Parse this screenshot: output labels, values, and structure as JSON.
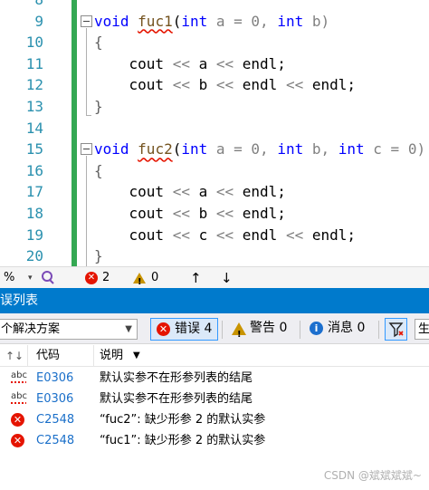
{
  "editor": {
    "lines": [
      {
        "num": "8"
      },
      {
        "num": "9"
      },
      {
        "num": "10"
      },
      {
        "num": "11"
      },
      {
        "num": "12"
      },
      {
        "num": "13"
      },
      {
        "num": "14"
      },
      {
        "num": "15"
      },
      {
        "num": "16"
      },
      {
        "num": "17"
      },
      {
        "num": "18"
      },
      {
        "num": "19"
      },
      {
        "num": "20"
      }
    ],
    "code": {
      "l9_kw": "void",
      "l9_fn": "fuc1",
      "l9_open": "(",
      "l9_int1": "int",
      "l9_a": " a = 0, ",
      "l9_int2": "int",
      "l9_b": " b)",
      "l10": "{",
      "l11": "    cout << a << endl;",
      "l12": "    cout << b << endl << endl;",
      "l13": "}",
      "l15_kw": "void",
      "l15_fn": "fuc2",
      "l15_open": "(",
      "l15_int1": "int",
      "l15_a": " a = 0, ",
      "l15_int2": "int",
      "l15_b": " b, ",
      "l15_int3": "int",
      "l15_c": " c = 0)",
      "l16": "{",
      "l17": "    cout << a << endl;",
      "l18": "    cout << b << endl;",
      "l19": "    cout << c << endl << endl;",
      "l20": "}"
    }
  },
  "status_strip": {
    "zoom": "%",
    "error_count": "2",
    "warning_count": "0",
    "up_arrow": "↑",
    "down_arrow": "↓"
  },
  "panel": {
    "title": "误列表",
    "scope": "个解决方案",
    "errors_label": "错误 4",
    "warnings_label": "警告 0",
    "messages_label": "消息 0",
    "search_glyph": "生"
  },
  "table": {
    "headers": {
      "code": "代码",
      "desc": "说明"
    },
    "rows": [
      {
        "icon": "spellcheck-icon",
        "code": "E0306",
        "desc": "默认实参不在形参列表的结尾"
      },
      {
        "icon": "spellcheck-icon",
        "code": "E0306",
        "desc": "默认实参不在形参列表的结尾"
      },
      {
        "icon": "error-icon",
        "code": "C2548",
        "desc": "“fuc2”: 缺少形参 2 的默认实参"
      },
      {
        "icon": "error-icon",
        "code": "C2548",
        "desc": "“fuc1”: 缺少形参 2 的默认实参"
      }
    ]
  },
  "watermark": "CSDN @斌斌斌斌~",
  "colors": {
    "accent": "#007acc",
    "error": "#e51400",
    "link": "#1a6fc9",
    "green_bar": "#34a853"
  }
}
